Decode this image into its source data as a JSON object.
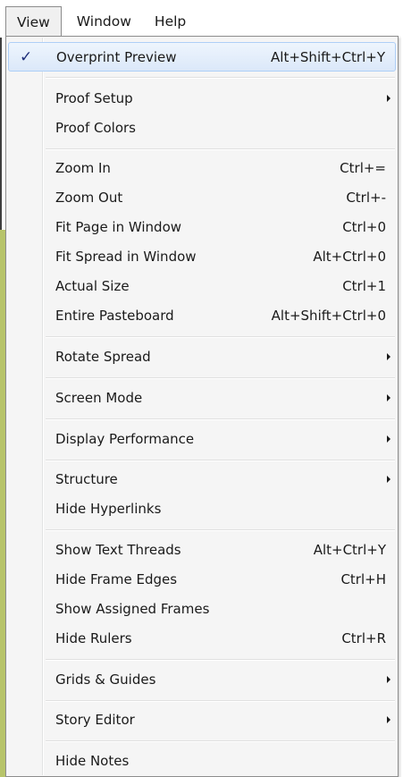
{
  "menubar": {
    "items": [
      "View",
      "Window",
      "Help"
    ]
  },
  "view_menu": {
    "items": [
      {
        "label": "Overprint Preview",
        "shortcut": "Alt+Shift+Ctrl+Y",
        "checked": true
      },
      {
        "label": "Proof Setup",
        "submenu": true
      },
      {
        "label": "Proof Colors"
      },
      {
        "label": "Zoom In",
        "shortcut": "Ctrl+="
      },
      {
        "label": "Zoom Out",
        "shortcut": "Ctrl+-"
      },
      {
        "label": "Fit Page in Window",
        "shortcut": "Ctrl+0"
      },
      {
        "label": "Fit Spread in Window",
        "shortcut": "Alt+Ctrl+0"
      },
      {
        "label": "Actual Size",
        "shortcut": "Ctrl+1"
      },
      {
        "label": "Entire Pasteboard",
        "shortcut": "Alt+Shift+Ctrl+0"
      },
      {
        "label": "Rotate Spread",
        "submenu": true
      },
      {
        "label": "Screen Mode",
        "submenu": true
      },
      {
        "label": "Display Performance",
        "submenu": true
      },
      {
        "label": "Structure",
        "submenu": true
      },
      {
        "label": "Hide Hyperlinks"
      },
      {
        "label": "Show Text Threads",
        "shortcut": "Alt+Ctrl+Y"
      },
      {
        "label": "Hide Frame Edges",
        "shortcut": "Ctrl+H"
      },
      {
        "label": "Show Assigned Frames"
      },
      {
        "label": "Hide Rulers",
        "shortcut": "Ctrl+R"
      },
      {
        "label": "Grids & Guides",
        "submenu": true
      },
      {
        "label": "Story Editor",
        "submenu": true
      },
      {
        "label": "Hide Notes"
      }
    ],
    "check_glyph": "✓"
  },
  "colors": {
    "menu_bg": "#f5f5f5",
    "highlight_border": "#aecff7",
    "check": "#1f2f7a",
    "doc_edge": "#b7c46a"
  }
}
